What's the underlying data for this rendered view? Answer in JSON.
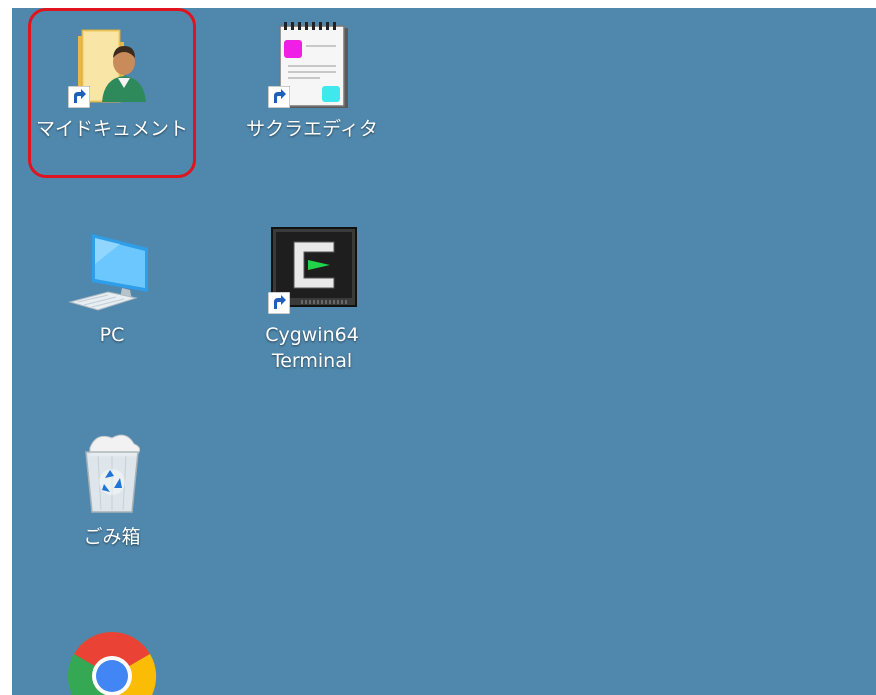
{
  "desktop": {
    "background_color": "#5088ad",
    "icons": [
      {
        "label": "マイドキュメント",
        "icon": "documents-folder-icon",
        "shortcut": true,
        "selected": true
      },
      {
        "label": "サクラエディタ",
        "icon": "sakura-editor-icon",
        "shortcut": true,
        "selected": false
      },
      {
        "label": "PC",
        "icon": "computer-monitor-icon",
        "shortcut": false,
        "selected": false
      },
      {
        "label": "Cygwin64\nTerminal",
        "icon": "cygwin-terminal-icon",
        "shortcut": true,
        "selected": false
      },
      {
        "label": "ごみ箱",
        "icon": "recycle-bin-icon",
        "shortcut": false,
        "selected": false
      },
      {
        "label": "",
        "icon": "chrome-icon",
        "shortcut": false,
        "selected": false
      }
    ],
    "selection_outline_color": "#e0141e"
  }
}
